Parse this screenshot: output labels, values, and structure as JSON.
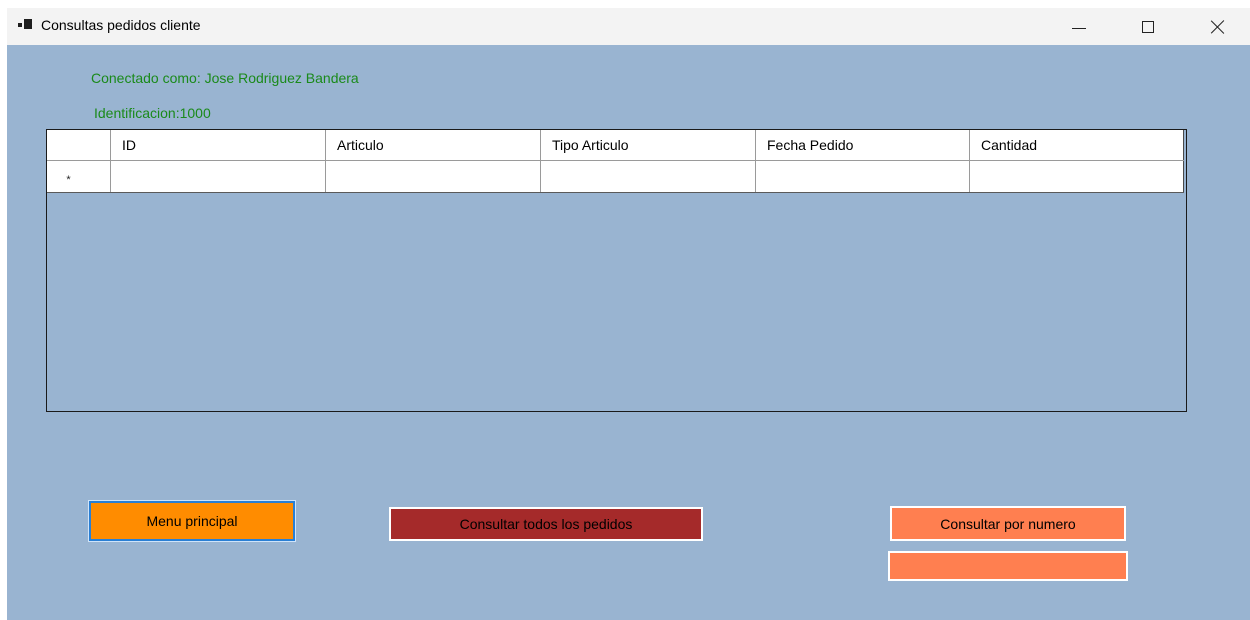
{
  "window": {
    "title": "Consultas pedidos cliente",
    "icons": {
      "app": "app-icon",
      "minimize": "minimize-icon",
      "maximize": "maximize-icon",
      "close": "close-icon"
    }
  },
  "user": {
    "connected_as": "Conectado como: Jose Rodriguez Bandera",
    "identification": "Identificacion:1000"
  },
  "grid": {
    "columns": [
      "ID",
      "Articulo",
      "Tipo Articulo",
      "Fecha Pedido",
      "Cantidad"
    ],
    "new_row_marker": "*",
    "rows": []
  },
  "buttons": {
    "main_menu": "Menu principal",
    "query_all": "Consultar todos los pedidos",
    "query_by_number": "Consultar por numero"
  },
  "order_number_input": {
    "value": "",
    "placeholder": ""
  },
  "colors": {
    "form_background": "#99b4d1",
    "label_text": "#1a8a1a",
    "main_menu_button": "#ff8c00",
    "query_all_button": "#a52a2a",
    "query_by_number_button": "#ff7f50"
  }
}
